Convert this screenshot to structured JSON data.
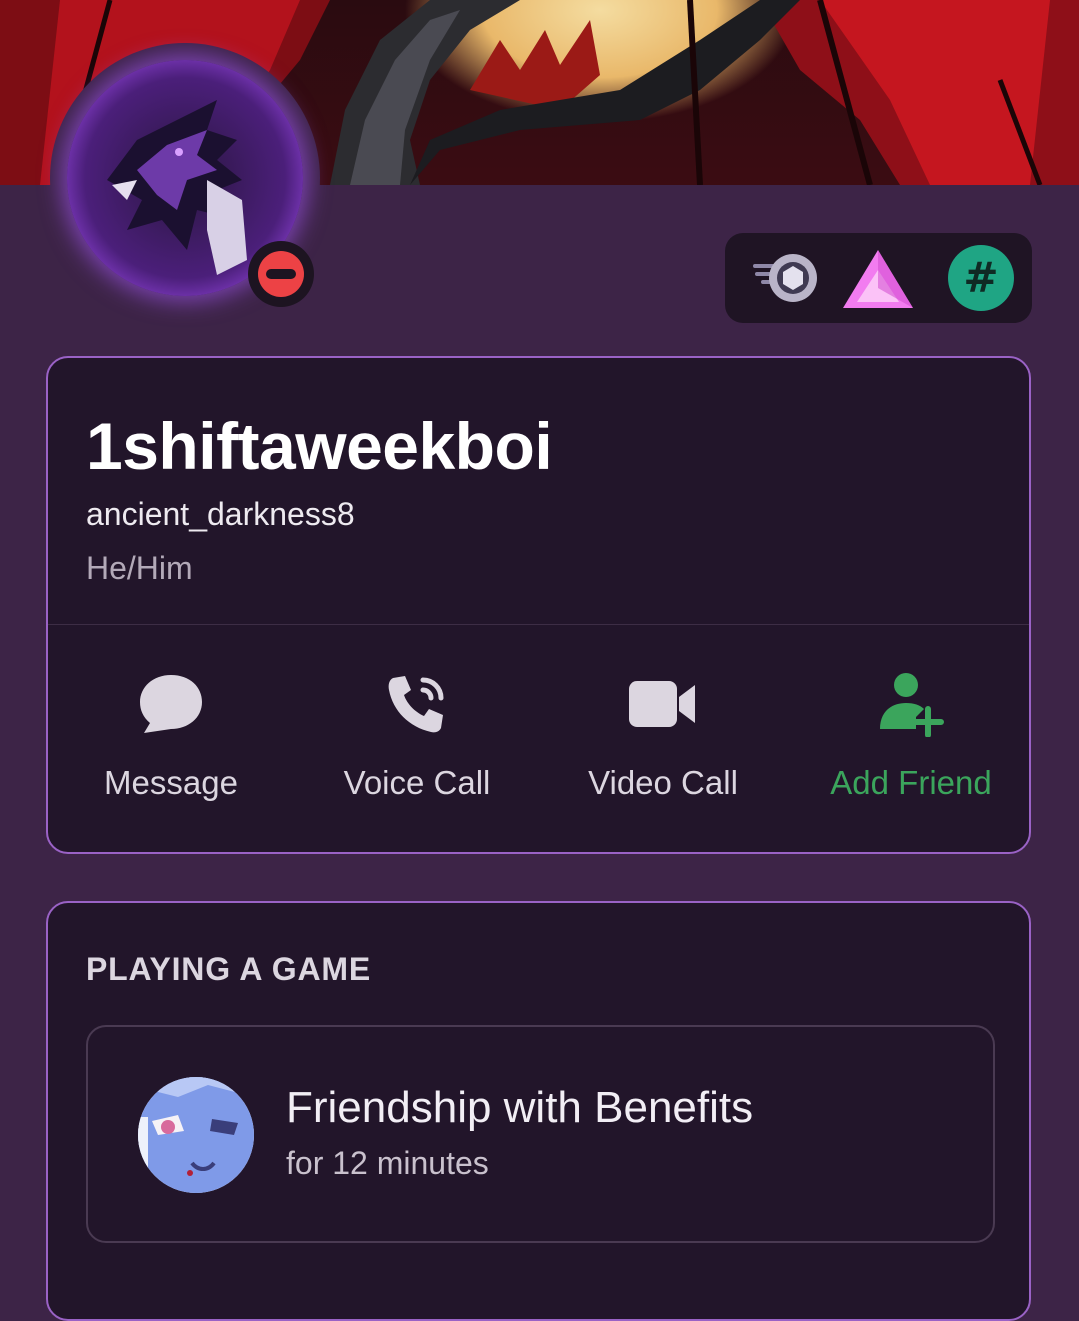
{
  "profile": {
    "display_name": "1shiftaweekboi",
    "username": "ancient_darkness8",
    "pronouns": "He/Him",
    "status": "do-not-disturb",
    "status_color": "#ed4245"
  },
  "badges": [
    {
      "icon": "nitro-boost-icon"
    },
    {
      "icon": "hypesquad-icon"
    },
    {
      "icon": "channel-hash-icon"
    }
  ],
  "actions": [
    {
      "label": "Message",
      "icon": "message-bubble-icon"
    },
    {
      "label": "Voice Call",
      "icon": "phone-icon"
    },
    {
      "label": "Video Call",
      "icon": "video-camera-icon"
    },
    {
      "label": "Add Friend",
      "icon": "add-friend-icon"
    }
  ],
  "activity": {
    "section_title": "PLAYING A GAME",
    "game_name": "Friendship with Benefits",
    "duration": "for 12 minutes"
  },
  "colors": {
    "background": "#3d2447",
    "card": "#22152a",
    "card_border": "#9a62c6",
    "accent_green": "#3ba55c"
  }
}
